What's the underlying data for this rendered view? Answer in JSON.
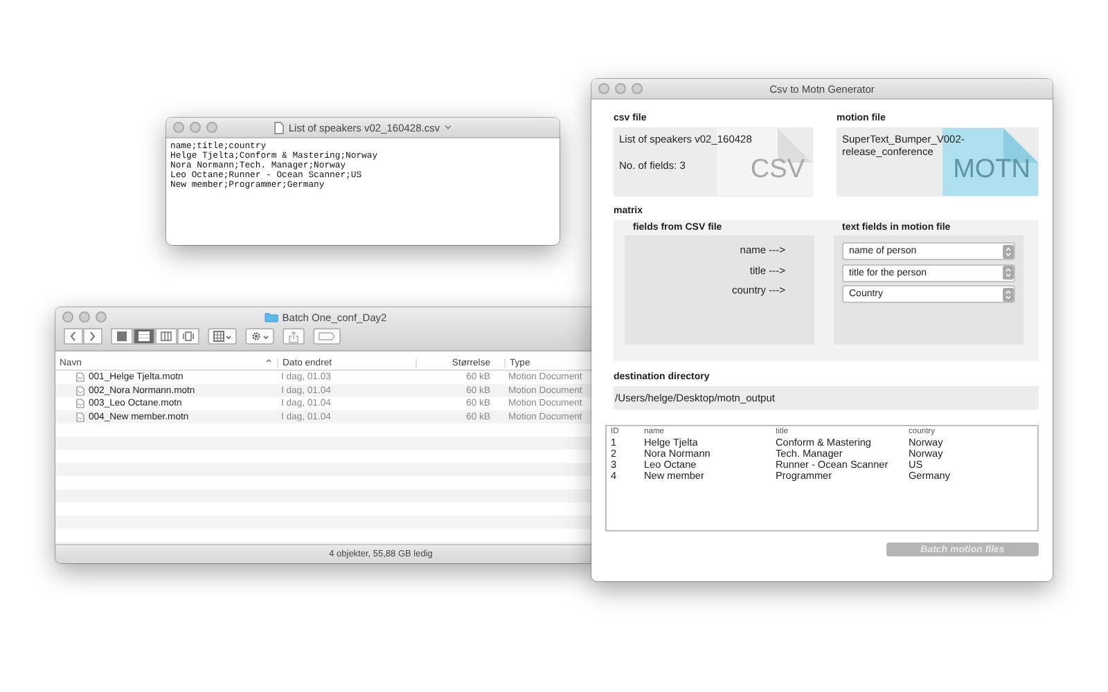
{
  "text_editor": {
    "title": "List of speakers v02_160428.csv",
    "lines": [
      "name;title;country",
      "Helge Tjelta;Conform & Mastering;Norway",
      "Nora Normann;Tech. Manager;Norway",
      "Leo Octane;Runner - Ocean Scanner;US",
      "New member;Programmer;Germany"
    ]
  },
  "finder": {
    "title": "Batch One_conf_Day2",
    "view_modes": [
      {
        "selected": false
      },
      {
        "selected": true
      },
      {
        "selected": false
      },
      {
        "selected": false
      }
    ],
    "columns": [
      "Navn",
      "Dato endret",
      "Størrelse",
      "Type"
    ],
    "rows": [
      {
        "name": "001_Helge Tjelta.motn",
        "date": "I dag, 01.03",
        "size": "60 kB",
        "type": "Motion Document"
      },
      {
        "name": "002_Nora Normann.motn",
        "date": "I dag, 01.04",
        "size": "60 kB",
        "type": "Motion Document"
      },
      {
        "name": "003_Leo Octane.motn",
        "date": "I dag, 01.04",
        "size": "60 kB",
        "type": "Motion Document"
      },
      {
        "name": "004_New member.motn",
        "date": "I dag, 01.04",
        "size": "60 kB",
        "type": "Motion Document"
      }
    ],
    "status": "4 objekter, 55,88 GB ledig"
  },
  "generator": {
    "title": "Csv to Motn Generator",
    "csv_file": {
      "label": "csv file",
      "name": "List of speakers v02_160428",
      "fields": "No. of fields: 3",
      "badge": "CSV"
    },
    "motion_file": {
      "label": "motion file",
      "name": "SuperText_Bumper_V002-release_conference",
      "badge": "MOTN"
    },
    "matrix": {
      "label": "matrix",
      "left_heading": "fields from CSV file",
      "right_heading": "text fields in motion file",
      "mappings": [
        {
          "source": "name --->",
          "target": "name of person"
        },
        {
          "source": "title --->",
          "target": "title for the person"
        },
        {
          "source": "country --->",
          "target": "Country"
        }
      ]
    },
    "destination": {
      "label": "destination directory",
      "path": "/Users/helge/Desktop/motn_output"
    },
    "table": {
      "columns": [
        "ID",
        "name",
        "title",
        "country"
      ],
      "rows": [
        [
          "1",
          "Helge Tjelta",
          "Conform & Mastering",
          "Norway"
        ],
        [
          "2",
          "Nora Normann",
          "Tech. Manager",
          "Norway"
        ],
        [
          "3",
          "Leo Octane",
          "Runner - Ocean Scanner",
          "US"
        ],
        [
          "4",
          "New member",
          "Programmer",
          "Germany"
        ]
      ]
    },
    "batch_button": {
      "label": "Batch motion files",
      "disabled": true
    }
  }
}
